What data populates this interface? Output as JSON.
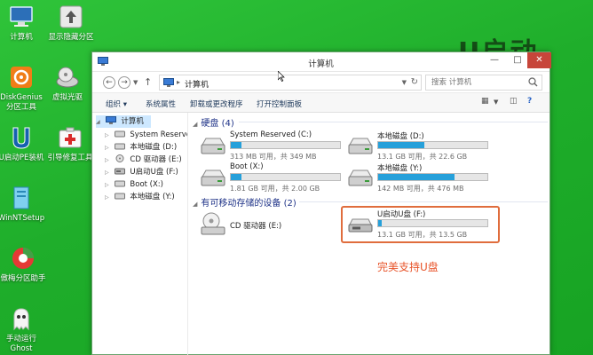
{
  "desktop": {
    "icons": [
      {
        "label": "计算机"
      },
      {
        "label": "显示隐藏分区"
      },
      {
        "label": "DiskGenius"
      },
      {
        "label": "分区工具"
      },
      {
        "label": "虚拟光驱"
      },
      {
        "label": "U启动PE装机"
      },
      {
        "label": "引导修复工具"
      },
      {
        "label": "WinNTSetup"
      },
      {
        "label": "傲梅分区助手"
      },
      {
        "label": "手动运行"
      },
      {
        "label": "Ghost"
      }
    ],
    "brand_text": "U启动"
  },
  "window": {
    "title": "计算机",
    "address": {
      "path": "计算机"
    },
    "search": {
      "placeholder": "搜索 计算机"
    },
    "toolbar": {
      "organize": "组织 ▾",
      "system_properties": "系统属性",
      "uninstall": "卸载或更改程序",
      "control_panel": "打开控制面板"
    },
    "nav": {
      "computer": "计算机",
      "items": [
        {
          "label": "System Reserved (C"
        },
        {
          "label": "本地磁盘 (D:)"
        },
        {
          "label": "CD 驱动器 (E:)"
        },
        {
          "label": "U启动U盘 (F:)"
        },
        {
          "label": "Boot (X:)"
        },
        {
          "label": "本地磁盘 (Y:)"
        }
      ]
    },
    "groups": {
      "hard_disks": "硬盘 (4)",
      "removable": "有可移动存储的设备 (2)"
    },
    "drives": [
      {
        "name": "System Reserved (C:)",
        "size": "313 MB 可用，共 349 MB",
        "used": 0.1
      },
      {
        "name": "本地磁盘 (D:)",
        "size": "13.1 GB 可用，共 22.6 GB",
        "used": 0.42
      },
      {
        "name": "Boot (X:)",
        "size": "1.81 GB 可用，共 2.00 GB",
        "used": 0.1
      },
      {
        "name": "本地磁盘 (Y:)",
        "size": "142 MB 可用，共 476 MB",
        "used": 0.7
      }
    ],
    "removable_drives": [
      {
        "name": "CD 驱动器 (E:)"
      },
      {
        "name": "U启动U盘 (F:)",
        "size": "13.1 GB 可用，共 13.5 GB",
        "used": 0.03
      }
    ]
  },
  "annotation": "完美支持U盘",
  "colors": {
    "desktop": "#22b02c",
    "bar_fill": "#26a0da",
    "highlight": "#e06d3d",
    "annotation": "#e8542a"
  }
}
